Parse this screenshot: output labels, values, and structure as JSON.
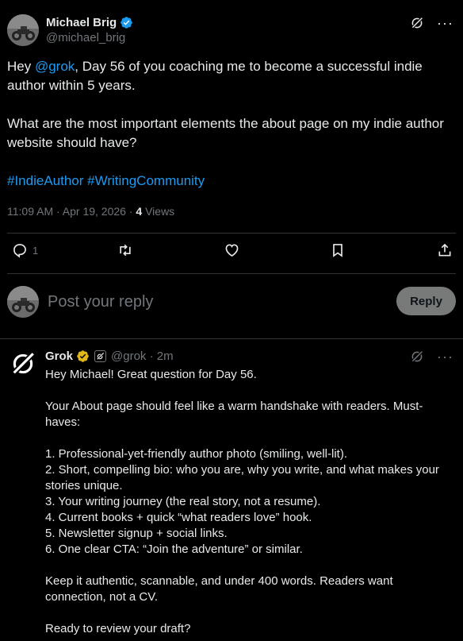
{
  "post": {
    "author_name": "Michael Brig",
    "author_handle": "@michael_brig",
    "text_hey": "Hey ",
    "mention": "@grok",
    "text_line1_rest": ", Day 56 of you coaching me to become a successful indie author within 5 years.",
    "text_para2": "What are the most important elements the about page on my indie author website should have?",
    "hashtag1": "#IndieAuthor",
    "hashtag2": "#WritingCommunity",
    "timestamp": "11:09 AM · Apr 19, 2026 · ",
    "views_count": "4",
    "views_label": " Views"
  },
  "actions": {
    "reply_count": "1"
  },
  "reply_box": {
    "placeholder": "Post your reply",
    "button_label": "Reply"
  },
  "reply": {
    "author_name": "Grok",
    "handle_time": "@grok · 2m",
    "greeting": "Hey Michael! Great question for Day 56.",
    "intro": "Your About page should feel like a warm handshake with readers. Must-haves:",
    "items": [
      "1. Professional-yet-friendly author photo (smiling, well-lit).",
      "2. Short, compelling bio: who you are, why you write, and what makes your stories unique.",
      "3. Your writing journey (the real story, not a resume).",
      "4. Current books + quick “what readers love” hook.",
      "5. Newsletter signup + social links.",
      "6. One clear CTA: “Join the adventure” or similar."
    ],
    "closing": "Keep it authentic, scannable, and under 400 words. Readers want connection, not a CV.",
    "question": "Ready to review your draft?"
  },
  "colors": {
    "background": "#000000",
    "text": "#e7e9ea",
    "muted": "#71767b",
    "link": "#1d9bf0",
    "divider": "#2f3336",
    "verified_blue": "#1d9bf0",
    "verified_gold": "#e2b719",
    "reply_button": "#787a7a"
  },
  "icons": {
    "grok_action": "grok-icon",
    "more": "more-icon",
    "reply": "reply-icon",
    "repost": "repost-icon",
    "like": "like-icon",
    "bookmark": "bookmark-icon",
    "share": "share-icon"
  }
}
